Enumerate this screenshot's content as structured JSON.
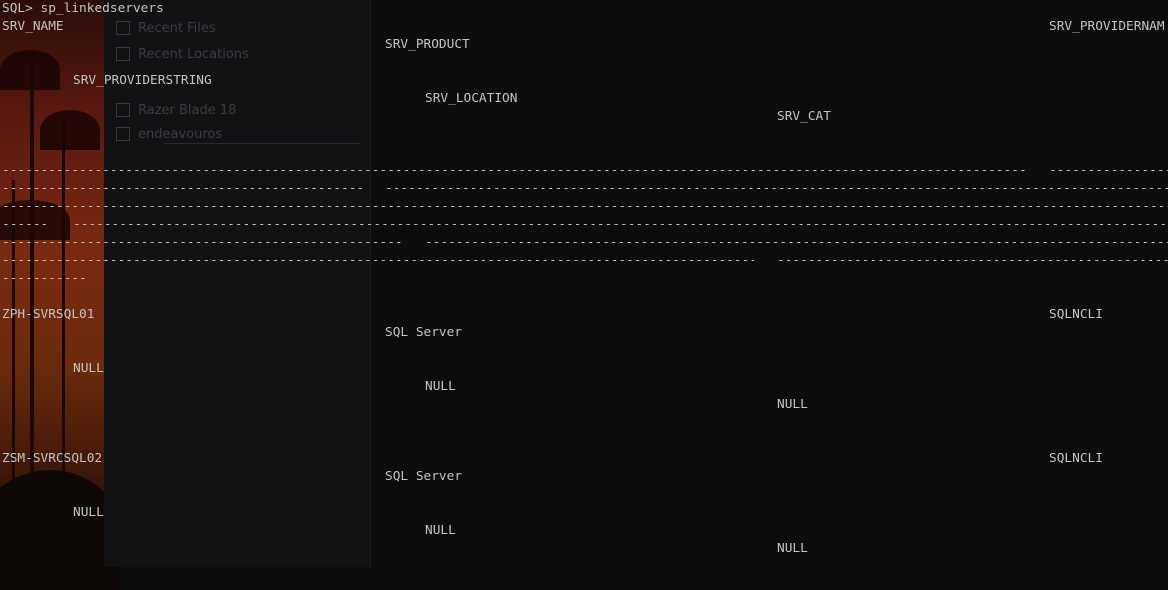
{
  "prompt": "SQL> sp_linkedservers",
  "headers": {
    "srv_name": "SRV_NAME",
    "srv_providername": "SRV_PROVIDERNAM",
    "srv_product": "SRV_PRODUCT",
    "srv_providerstring": "SRV_PROVIDERSTRING",
    "srv_location": "SRV_LOCATION",
    "srv_cat": "SRV_CAT"
  },
  "rows": [
    {
      "srv_name": "ZPH-SVRSQL01",
      "srv_providername": "SQLNCLI",
      "srv_product": "SQL Server",
      "srv_providerstring": "NULL",
      "srv_location": "NULL",
      "srv_cat": "NULL"
    },
    {
      "srv_name": "ZSM-SVRCSQL02",
      "srv_providername": "SQLNCLI",
      "srv_product": "SQL Server",
      "srv_providerstring": "NULL",
      "srv_location": "NULL",
      "srv_cat": "NULL"
    }
  ],
  "file_panel": {
    "items": [
      {
        "label": "Recent Files",
        "icon": "recent-files-icon"
      },
      {
        "label": "Recent Locations",
        "icon": "recent-locations-icon"
      },
      {
        "label": "Razer Blade 18",
        "icon": "drive-icon"
      },
      {
        "label": "endeavouros",
        "icon": "drive-icon"
      }
    ]
  }
}
